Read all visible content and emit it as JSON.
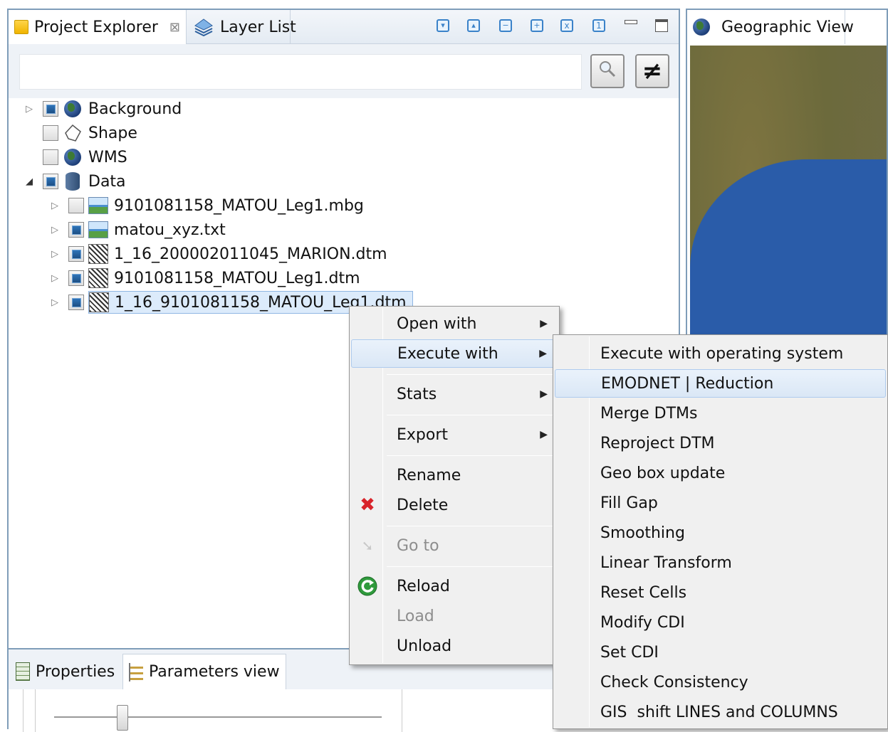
{
  "left_panel": {
    "tabs": [
      {
        "label": "Project Explorer",
        "close_glyph": "⊠"
      },
      {
        "label": "Layer List"
      }
    ],
    "toolbar_icons": [
      "collapse-down-icon",
      "collapse-up-icon",
      "collapse-all-icon",
      "expand-all-icon",
      "filter-x-icon",
      "filter-1-icon",
      "minimize-icon",
      "maximize-icon"
    ],
    "search": {
      "value": "",
      "placeholder": ""
    },
    "search_button_icon": "magnifier-icon",
    "not_equal_button": "≠",
    "tree": [
      {
        "label": "Background",
        "checked": true,
        "expanded": false,
        "icon": "globe-icon"
      },
      {
        "label": "Shape",
        "checked": false,
        "icon": "shape-icon"
      },
      {
        "label": "WMS",
        "checked": false,
        "icon": "wms-globe-icon"
      },
      {
        "label": "Data",
        "checked": true,
        "expanded": true,
        "icon": "database-icon"
      }
    ],
    "data_children": [
      {
        "label": "9101081158_MATOU_Leg1.mbg",
        "checked": false,
        "icon": "image-layer-icon"
      },
      {
        "label": "matou_xyz.txt",
        "checked": true,
        "icon": "image-layer-icon"
      },
      {
        "label": "1_16_200002011045_MARION.dtm",
        "checked": true,
        "icon": "dtm-icon"
      },
      {
        "label": "9101081158_MATOU_Leg1.dtm",
        "checked": true,
        "icon": "dtm-icon"
      },
      {
        "label": "1_16_9101081158_MATOU_Leg1.dtm",
        "checked": true,
        "icon": "dtm-icon",
        "selected": true
      }
    ],
    "bottom_tabs": [
      {
        "label": "Properties"
      },
      {
        "label": "Parameters view"
      }
    ]
  },
  "right_panel": {
    "tab": {
      "label": "Geographic View"
    }
  },
  "context_menu": {
    "items": [
      {
        "label": "Open with",
        "submenu": true
      },
      {
        "label": "Execute with",
        "submenu": true,
        "highlighted": true
      },
      {
        "label": "Stats",
        "submenu": true
      },
      {
        "label": "Export",
        "submenu": true
      },
      {
        "label": "Rename"
      },
      {
        "label": "Delete",
        "icon": "delete-x-icon"
      },
      {
        "label": "Go to",
        "disabled": true,
        "icon": "goto-arrow-icon"
      },
      {
        "label": "Reload",
        "icon": "reload-icon"
      },
      {
        "label": "Load",
        "disabled": true
      },
      {
        "label": "Unload"
      }
    ],
    "submenu_arrow": "▶"
  },
  "submenu": {
    "items": [
      {
        "label": "Execute with operating system"
      },
      {
        "label": "EMODNET | Reduction",
        "highlighted": true
      },
      {
        "label": "Merge DTMs"
      },
      {
        "label": "Reproject DTM"
      },
      {
        "label": "Geo box update"
      },
      {
        "label": "Fill Gap"
      },
      {
        "label": "Smoothing"
      },
      {
        "label": "Linear Transform"
      },
      {
        "label": "Reset Cells"
      },
      {
        "label": "Modify CDI"
      },
      {
        "label": "Set CDI"
      },
      {
        "label": "Check Consistency"
      },
      {
        "label": "GIS  shift LINES and COLUMNS"
      }
    ]
  },
  "colors": {
    "selection": "#dcebfb",
    "highlight_border": "#aecbee",
    "checkbox_fill": "#2e73b8",
    "delete_red": "#d8232a",
    "reload_green": "#2f9a3c"
  }
}
